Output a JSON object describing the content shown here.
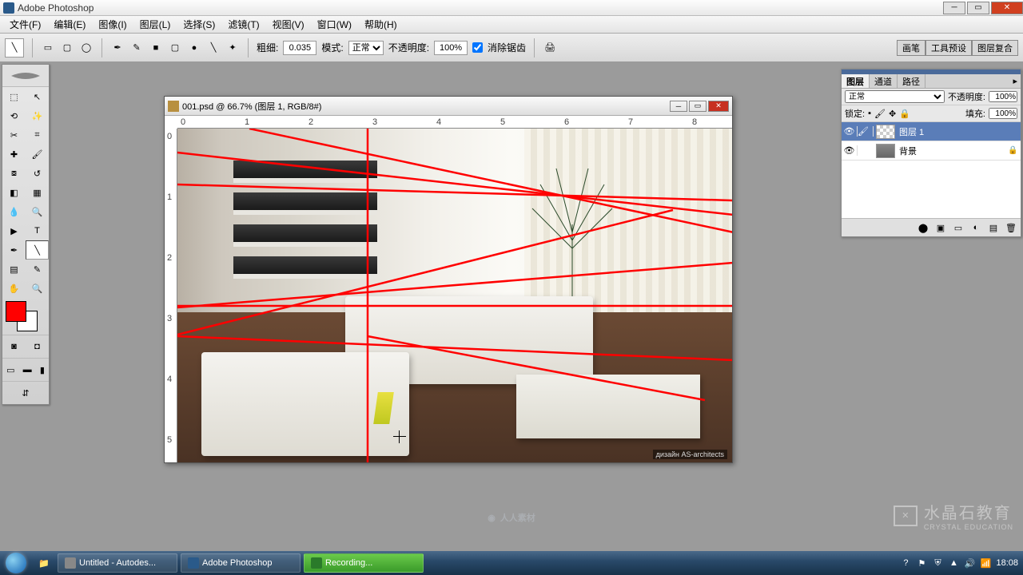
{
  "app": {
    "title": "Adobe Photoshop"
  },
  "menu": [
    "文件(F)",
    "编辑(E)",
    "图像(I)",
    "图层(L)",
    "选择(S)",
    "滤镜(T)",
    "视图(V)",
    "窗口(W)",
    "帮助(H)"
  ],
  "options": {
    "weight_label": "粗细:",
    "weight_value": "0.035",
    "mode_label": "模式:",
    "mode_value": "正常",
    "opacity_label": "不透明度:",
    "opacity_value": "100%",
    "antialias_label": "消除锯齿",
    "wells": [
      "画笔",
      "工具预设",
      "图层复合"
    ]
  },
  "document": {
    "title": "001.psd @ 66.7% (图层 1, RGB/8#)",
    "watermark": "дизайн AS-architects",
    "ruler_h": [
      "0",
      "1",
      "2",
      "3",
      "4",
      "5",
      "6",
      "7",
      "8"
    ],
    "ruler_v": [
      "0",
      "1",
      "2",
      "3",
      "4",
      "5"
    ]
  },
  "layers_panel": {
    "tabs": [
      "图层",
      "通道",
      "路径"
    ],
    "blend_mode": "正常",
    "opacity_label": "不透明度:",
    "opacity_value": "100%",
    "lock_label": "锁定:",
    "fill_label": "填充:",
    "fill_value": "100%",
    "layers": [
      {
        "name": "图层 1",
        "visible": true,
        "active": true,
        "locked": false,
        "bg": false
      },
      {
        "name": "背景",
        "visible": true,
        "active": false,
        "locked": true,
        "bg": true
      }
    ]
  },
  "watermarks": {
    "center": "人人素材",
    "right_cn": "水晶石教育",
    "right_en": "CRYSTAL EDUCATION"
  },
  "taskbar": {
    "items": [
      {
        "label": "Untitled - Autodes...",
        "rec": false
      },
      {
        "label": "Adobe Photoshop",
        "rec": false
      },
      {
        "label": "Recording...",
        "rec": true
      }
    ],
    "time": "18:08"
  }
}
